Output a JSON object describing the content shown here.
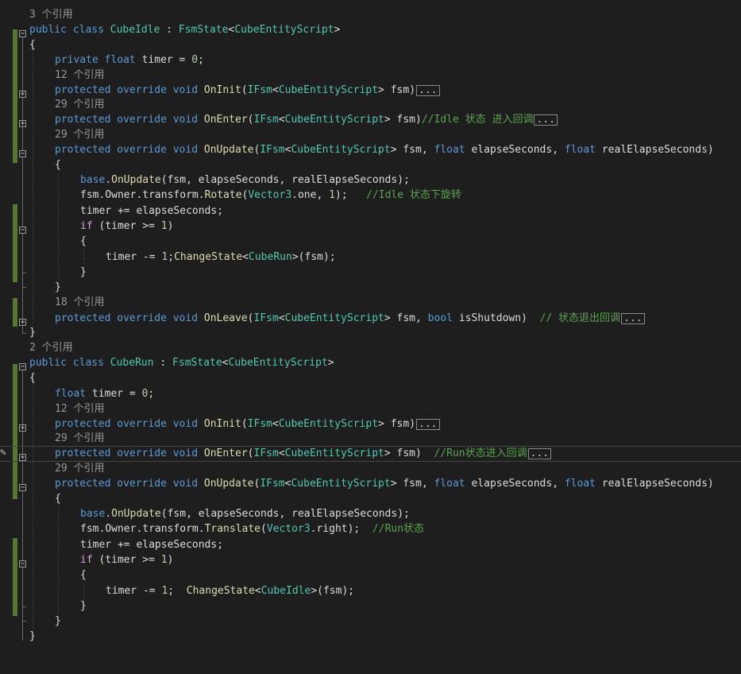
{
  "refs": {
    "r3": "3 个引用",
    "r12": "12 个引用",
    "r29": "29 个引用",
    "r18": "18 个引用",
    "r2": "2 个引用"
  },
  "kw": {
    "public": "public",
    "class": "class",
    "private": "private",
    "float": "float",
    "protected": "protected",
    "override": "override",
    "void": "void",
    "bool": "bool",
    "base": "base",
    "if": "if"
  },
  "types": {
    "CubeIdle": "CubeIdle",
    "CubeRun": "CubeRun",
    "FsmState": "FsmState",
    "CubeEntityScript": "CubeEntityScript",
    "IFsm": "IFsm",
    "Vector3": "Vector3"
  },
  "methods": {
    "OnInit": "OnInit",
    "OnEnter": "OnEnter",
    "OnUpdate": "OnUpdate",
    "OnLeave": "OnLeave",
    "Rotate": "Rotate",
    "Translate": "Translate",
    "ChangeState": "ChangeState"
  },
  "ident": {
    "timer": "timer",
    "fsm": "fsm",
    "elapseSeconds": "elapseSeconds",
    "realElapseSeconds": "realElapseSeconds",
    "isShutdown": "isShutdown",
    "Owner": "Owner",
    "transform": "transform",
    "one": "one",
    "right": "right"
  },
  "nums": {
    "zero": "0",
    "one": "1"
  },
  "comments": {
    "idle_enter": "//Idle 状态 进入回调",
    "idle_rotate": "//Idle 状态下旋转",
    "leave": "// 状态退出回调",
    "run_enter": "//Run状态进入回调",
    "run_state": "//Run状态"
  },
  "collapsed_label": "..."
}
